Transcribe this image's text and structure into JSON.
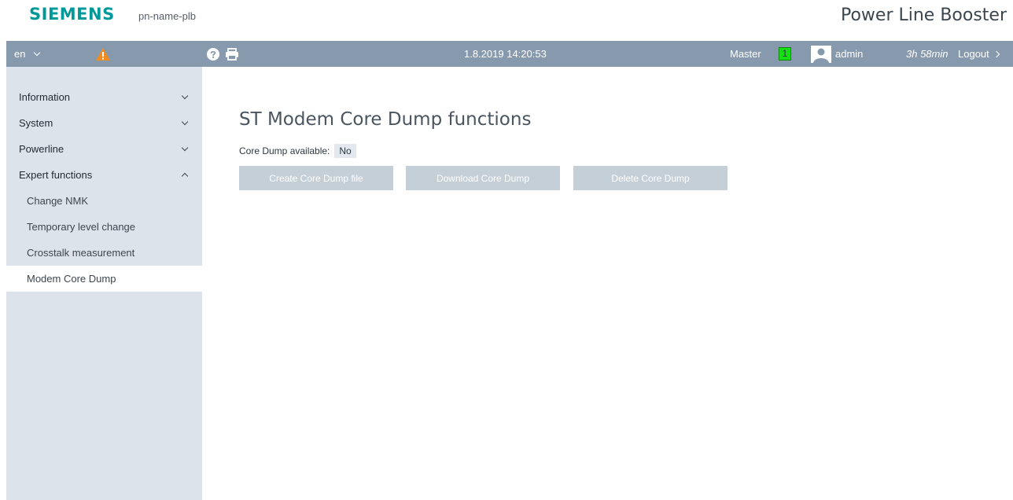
{
  "header": {
    "logo": "SIEMENS",
    "device_name": "pn-name-plb",
    "product_title": "Power Line Booster"
  },
  "topbar": {
    "language": "en",
    "datetime": "1.8.2019 14:20:53",
    "role_label": "Master",
    "role_value": "1",
    "username": "admin",
    "session_time": "3h 58min",
    "logout_label": "Logout",
    "icons": [
      "chevron-down-icon",
      "warning-icon",
      "help-icon",
      "print-icon",
      "user-icon",
      "chevron-right-icon"
    ],
    "colors": {
      "bar": "#879aad",
      "warning": "#f08c1e",
      "role_indicator": "#14e014"
    }
  },
  "sidebar": {
    "items": [
      {
        "label": "Information",
        "expanded": false
      },
      {
        "label": "System",
        "expanded": false
      },
      {
        "label": "Powerline",
        "expanded": false
      },
      {
        "label": "Expert functions",
        "expanded": true
      }
    ],
    "subitems": [
      {
        "label": "Change NMK",
        "active": false
      },
      {
        "label": "Temporary level change",
        "active": false
      },
      {
        "label": "Crosstalk measurement",
        "active": false
      },
      {
        "label": "Modem Core Dump",
        "active": true
      }
    ]
  },
  "main": {
    "title": "ST Modem Core Dump functions",
    "available_label": "Core Dump available:",
    "available_value": "No",
    "buttons": {
      "create": "Create Core Dump file",
      "download": "Download Core Dump",
      "delete": "Delete Core Dump"
    }
  }
}
